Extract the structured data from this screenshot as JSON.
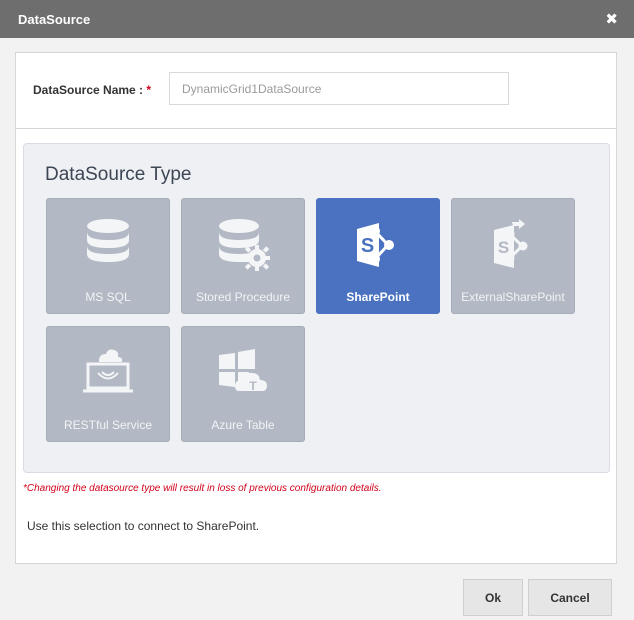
{
  "dialog": {
    "title": "DataSource",
    "close_symbol": "✖"
  },
  "name_field": {
    "label": "DataSource Name : ",
    "required_marker": "*",
    "value": "DynamicGrid1DataSource"
  },
  "type_section": {
    "title": "DataSource Type",
    "tiles": [
      {
        "label": "MS SQL",
        "icon": "database-icon",
        "selected": false
      },
      {
        "label": "Stored Procedure",
        "icon": "database-gear-icon",
        "selected": false
      },
      {
        "label": "SharePoint",
        "icon": "sharepoint-icon",
        "selected": true
      },
      {
        "label": "ExternalSharePoint",
        "icon": "external-sharepoint-icon",
        "selected": false
      },
      {
        "label": "RESTful Service",
        "icon": "cloud-laptop-icon",
        "selected": false
      },
      {
        "label": "Azure Table",
        "icon": "windows-cloud-icon",
        "selected": false
      }
    ]
  },
  "warning": "*Changing the datasource type will result in loss of previous configuration details.",
  "description": "Use this selection to connect to SharePoint.",
  "buttons": {
    "ok": "Ok",
    "cancel": "Cancel"
  },
  "colors": {
    "titlebar": "#6e6e6e",
    "tile": "#b3b9c4",
    "tile_selected": "#4a72c0",
    "required": "#d0021b"
  }
}
